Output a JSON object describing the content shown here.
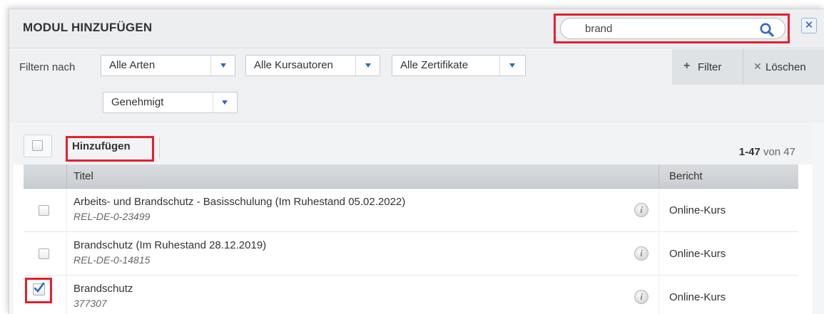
{
  "dialog": {
    "title": "MODUL HINZUFÜGEN",
    "search_value": "brand",
    "close_label": "✕"
  },
  "filters": {
    "label": "Filtern nach",
    "selects": [
      {
        "value": "Alle Arten"
      },
      {
        "value": "Alle Kursautoren"
      },
      {
        "value": "Alle Zertifikate"
      },
      {
        "value": "Genehmigt"
      }
    ],
    "filter_button": "Filter",
    "clear_button": "Löschen"
  },
  "toolbar": {
    "add_label": "Hinzufügen",
    "range": "1-47",
    "of_label": "von 47"
  },
  "table": {
    "headers": {
      "title": "Titel",
      "report": "Bericht"
    },
    "rows": [
      {
        "title": "Arbeits- und Brandschutz - Basisschulung (Im Ruhestand 05.02.2022)",
        "code": "REL-DE-0-23499",
        "type": "Online-Kurs",
        "checked": false
      },
      {
        "title": "Brandschutz (Im Ruhestand 28.12.2019)",
        "code": "REL-DE-0-14815",
        "type": "Online-Kurs",
        "checked": false
      },
      {
        "title": "Brandschutz",
        "code": "377307",
        "type": "Online-Kurs",
        "checked": true
      }
    ]
  },
  "colors": {
    "highlight": "#e4202e",
    "accent": "#2d6ac4"
  }
}
